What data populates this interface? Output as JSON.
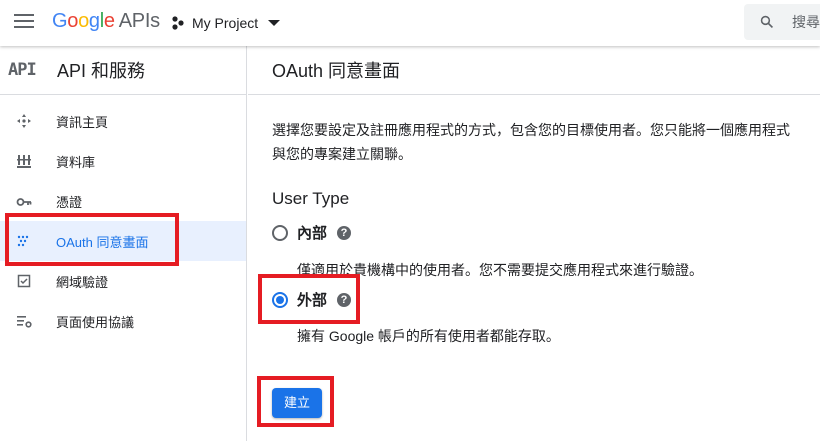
{
  "header": {
    "logo_google": [
      "G",
      "o",
      "o",
      "g",
      "l",
      "e"
    ],
    "logo_suffix": "APIs",
    "project_name": "My Project",
    "search_placeholder": "搜尋"
  },
  "sidebar": {
    "api_logo": "API",
    "title": "API 和服務",
    "items": [
      {
        "label": "資訊主頁",
        "icon": "dashboard-icon"
      },
      {
        "label": "資料庫",
        "icon": "library-icon"
      },
      {
        "label": "憑證",
        "icon": "key-icon"
      },
      {
        "label": "OAuth 同意畫面",
        "icon": "consent-icon",
        "active": true
      },
      {
        "label": "網域驗證",
        "icon": "checkbox-icon"
      },
      {
        "label": "頁面使用協議",
        "icon": "settings-list-icon"
      }
    ]
  },
  "main": {
    "title": "OAuth 同意畫面",
    "description": "選擇您要設定及註冊應用程式的方式，包含您的目標使用者。您只能將一個應用程式與您的專案建立關聯。",
    "section_title": "User Type",
    "options": [
      {
        "label": "內部",
        "description": "僅適用於貴機構中的使用者。您不需要提交應用程式來進行驗證。",
        "selected": false
      },
      {
        "label": "外部",
        "description": "擁有 Google 帳戶的所有使用者都能存取。",
        "selected": true
      }
    ],
    "help_glyph": "?",
    "create_label": "建立"
  },
  "colors": {
    "accent": "#1a73e8",
    "highlight": "#e51c23",
    "active_bg": "#e8f0fe"
  }
}
